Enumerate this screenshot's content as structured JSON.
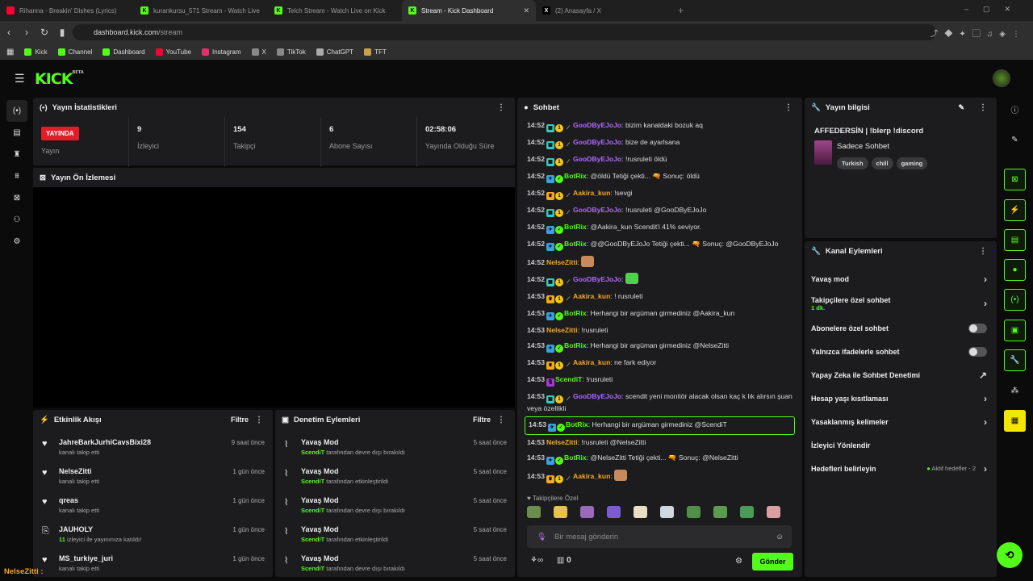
{
  "browser": {
    "tabs": [
      {
        "label": "Rihanna - Breakin' Dishes (Lyrics)",
        "icon": "youtube-icon",
        "active": false
      },
      {
        "label": "kurankursu_571 Stream - Watch Live",
        "icon": "kick-icon",
        "active": false
      },
      {
        "label": "Telch Stream - Watch Live on Kick",
        "icon": "kick-icon",
        "active": false
      },
      {
        "label": "Stream - Kick Dashboard",
        "icon": "kick-icon",
        "active": true
      },
      {
        "label": "(2) Anasayfa / X",
        "icon": "x-icon",
        "active": false
      }
    ],
    "url_host": "dashboard.kick.com",
    "url_path": "/stream",
    "bookmarks": [
      "Kick",
      "Channel",
      "Dashboard",
      "YouTube",
      "Instagram",
      "X",
      "TikTok",
      "ChatGPT",
      "TFT"
    ]
  },
  "brand": {
    "logo": "KICK",
    "beta": "BETA",
    "accent": "#53fc18"
  },
  "stats": {
    "title": "Yayın İstatistikleri",
    "live_badge": "YAYINDA",
    "items": [
      {
        "value": "",
        "label": "Yayın"
      },
      {
        "value": "9",
        "label": "İzleyici"
      },
      {
        "value": "154",
        "label": "Takipçi"
      },
      {
        "value": "6",
        "label": "Abone Sayısı"
      },
      {
        "value": "02:58:06",
        "label": "Yayında Olduğu Süre"
      }
    ]
  },
  "preview": {
    "title": "Yayın Ön İzlemesi"
  },
  "activity": {
    "title": "Etkinlik Akışı",
    "filter": "Filtre",
    "items": [
      {
        "name": "JahreBarkJurhiCavsBixi28",
        "sub": "kanalı takip etti",
        "time": "9 saat önce"
      },
      {
        "name": "NelseZitti",
        "sub": "kanalı takip etti",
        "time": "1 gün önce"
      },
      {
        "name": "qreas",
        "sub": "kanalı takip etti",
        "time": "1 gün önce"
      },
      {
        "name": "JAUHOLY",
        "sub_count": "11",
        "sub": "izleyici ile yayınınıza katıldı!",
        "time": "1 gün önce"
      },
      {
        "name": "MS_turkiye_juri",
        "sub": "kanalı takip etti",
        "time": "1 gün önce"
      }
    ]
  },
  "moderation": {
    "title": "Denetim Eylemleri",
    "filter": "Filtre",
    "items": [
      {
        "name": "Yavaş Mod",
        "actor": "ScendiT",
        "sub": "tarafından devre dışı bırakıldı",
        "time": "5 saat önce"
      },
      {
        "name": "Yavaş Mod",
        "actor": "ScendiT",
        "sub": "tarafından etkinleştirildi",
        "time": "5 saat önce"
      },
      {
        "name": "Yavaş Mod",
        "actor": "ScendiT",
        "sub": "tarafından devre dışı bırakıldı",
        "time": "5 saat önce"
      },
      {
        "name": "Yavaş Mod",
        "actor": "ScendiT",
        "sub": "tarafından etkinleştirildi",
        "time": "5 saat önce"
      },
      {
        "name": "Yavaş Mod",
        "actor": "ScendiT",
        "sub": "tarafından devre dışı bırakıldı",
        "time": "5 saat önce"
      }
    ]
  },
  "chat": {
    "title": "Sohbet",
    "messages": [
      {
        "t": "14:52",
        "u": "GooDByEJoJo",
        "c": "#b066ff",
        "m": "bizim kanaldaki bozuk aq"
      },
      {
        "t": "14:52",
        "u": "GooDByEJoJo",
        "c": "#b066ff",
        "m": "bize de ayarlsana"
      },
      {
        "t": "14:52",
        "u": "GooDByEJoJo",
        "c": "#b066ff",
        "m": "!rusruleti öldü"
      },
      {
        "t": "14:52",
        "u": "BotRix",
        "c": "#53fc18",
        "m": "@öldü Tetiği çekti... 🔫 Sonuç: öldü"
      },
      {
        "t": "14:52",
        "u": "Aakira_kun",
        "c": "#f5a623",
        "m": "!sevgi"
      },
      {
        "t": "14:52",
        "u": "GooDByEJoJo",
        "c": "#b066ff",
        "m": "!rusruleti @GooDByEJoJo"
      },
      {
        "t": "14:52",
        "u": "BotRix",
        "c": "#53fc18",
        "m": "@Aakira_kun Scendit'i 41% seviyor."
      },
      {
        "t": "14:52",
        "u": "BotRix",
        "c": "#53fc18",
        "m": "@@GooDByEJoJo Tetiği çekti... 🔫 Sonuç: @GooDByEJoJo"
      },
      {
        "t": "14:52",
        "u": "NelseZitti",
        "c": "#f5a623",
        "m": ""
      },
      {
        "t": "14:52",
        "u": "GooDByEJoJo",
        "c": "#b066ff",
        "m": ""
      },
      {
        "t": "14:53",
        "u": "Aakira_kun",
        "c": "#f5a623",
        "m": "! rusruleti"
      },
      {
        "t": "14:53",
        "u": "BotRix",
        "c": "#53fc18",
        "m": "Herhangi bir argüman girmediniz @Aakira_kun"
      },
      {
        "t": "14:53",
        "u": "NelseZitti",
        "c": "#f5a623",
        "m": "!rusruleti"
      },
      {
        "t": "14:53",
        "u": "BotRix",
        "c": "#53fc18",
        "m": "Herhangi bir argüman girmediniz @NelseZitti"
      },
      {
        "t": "14:53",
        "u": "Aakira_kun",
        "c": "#f5a623",
        "m": "ne fark ediyor"
      },
      {
        "t": "14:53",
        "u": "ScendiT",
        "c": "#53fc18",
        "m": "!rusruleti"
      },
      {
        "t": "14:53",
        "u": "GooDByEJoJo",
        "c": "#b066ff",
        "m": "scendit yeni monitör alacak olsan kaç k lık alırsın şuan veya özellikli"
      },
      {
        "t": "14:53",
        "u": "BotRix",
        "c": "#53fc18",
        "m": "Herhangi bir argüman girmediniz @ScendiT",
        "hl": true
      },
      {
        "t": "14:53",
        "u": "NelseZitti",
        "c": "#f5a623",
        "m": "!rusruleti @NelseZitti"
      },
      {
        "t": "14:53",
        "u": "BotRix",
        "c": "#53fc18",
        "m": "@NelseZitti Tetiği çekti... 🔫 Sonuç: @NelseZitti"
      },
      {
        "t": "14:53",
        "u": "Aakira_kun",
        "c": "#f5a623",
        "m": ""
      }
    ],
    "followers_only": "Takipçilere Özel",
    "input_placeholder": "Bir mesaj gönderin",
    "points": "0",
    "send": "Gönder"
  },
  "streaminfo": {
    "title": "Yayın bilgisi",
    "stream_title": "AFFEDERSİN | !blerp !discord",
    "category": "Sadece Sohbet",
    "tags": [
      "Turkish",
      "chill",
      "gaming"
    ]
  },
  "channel_actions": {
    "title": "Kanal Eylemleri",
    "rows": [
      {
        "label": "Yavaş mod",
        "type": "chevron"
      },
      {
        "label": "Takipçilere özel sohbet",
        "sub": "1 dk.",
        "type": "chevron"
      },
      {
        "label": "Abonelere özel sohbet",
        "type": "toggle"
      },
      {
        "label": "Yalnızca ifadelerle sohbet",
        "type": "toggle"
      },
      {
        "label": "Yapay Zeka ile Sohbet Denetimi",
        "type": "external"
      },
      {
        "label": "Hesap yaşı kısıtlaması",
        "type": "chevron"
      },
      {
        "label": "Yasaklanmış kelimeler",
        "type": "chevron"
      },
      {
        "label": "İzleyici Yönlendir",
        "type": "none"
      },
      {
        "label": "Hedefleri belirleyin",
        "extra": "Aktif hedefler - 2",
        "type": "chevron"
      }
    ]
  },
  "overlay_user": "NelseZitti :"
}
